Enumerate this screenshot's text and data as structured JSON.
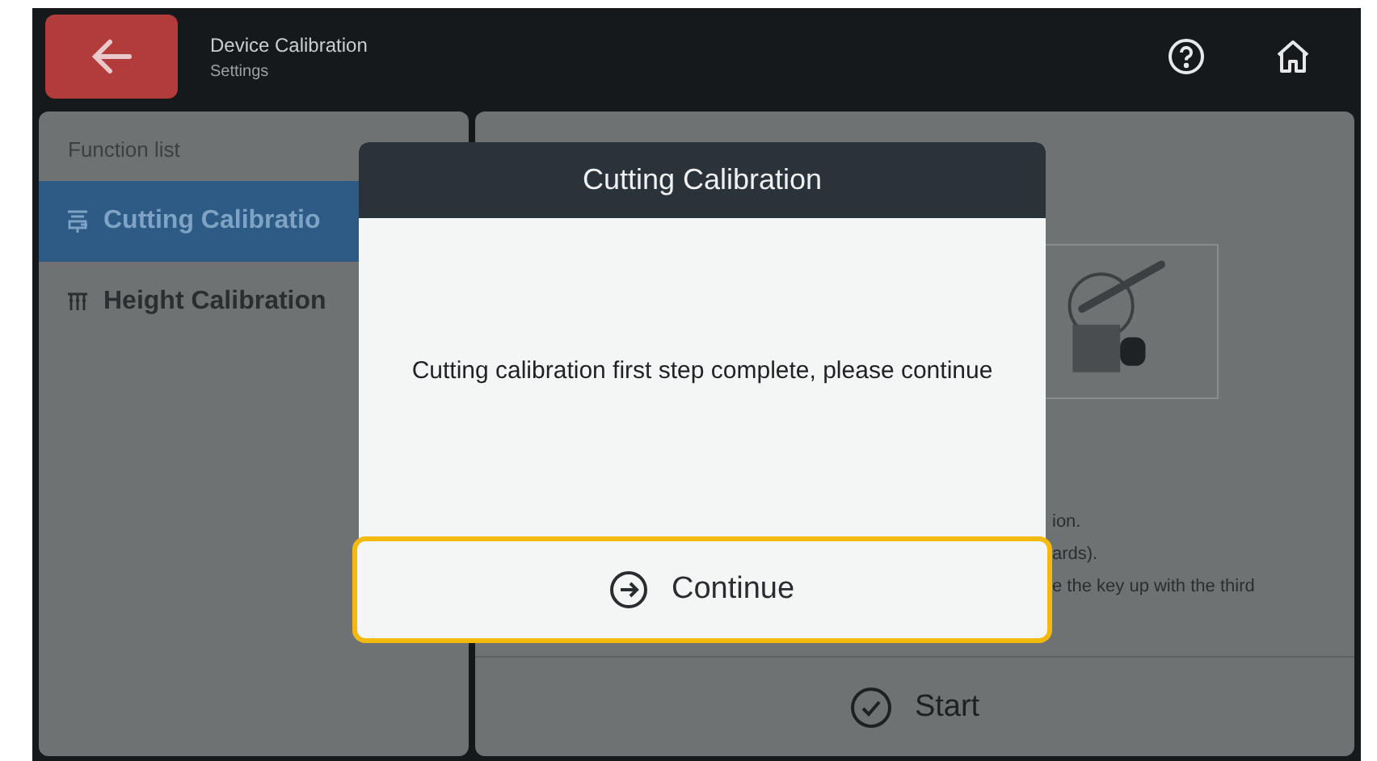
{
  "header": {
    "title": "Device Calibration",
    "subtitle": "Settings"
  },
  "sidebar": {
    "heading": "Function list",
    "items": [
      {
        "label": "Cutting Calibratio",
        "kind": "cutter",
        "selected": true
      },
      {
        "label": "Height Calibration",
        "kind": "height",
        "selected": false
      }
    ]
  },
  "panel": {
    "instructions": [
      "ion.",
      "ards).",
      "e the key up with the third"
    ],
    "start_button": "Start"
  },
  "dialog": {
    "title": "Cutting Calibration",
    "message": "Cutting calibration first step complete, please continue",
    "button": "Continue"
  }
}
